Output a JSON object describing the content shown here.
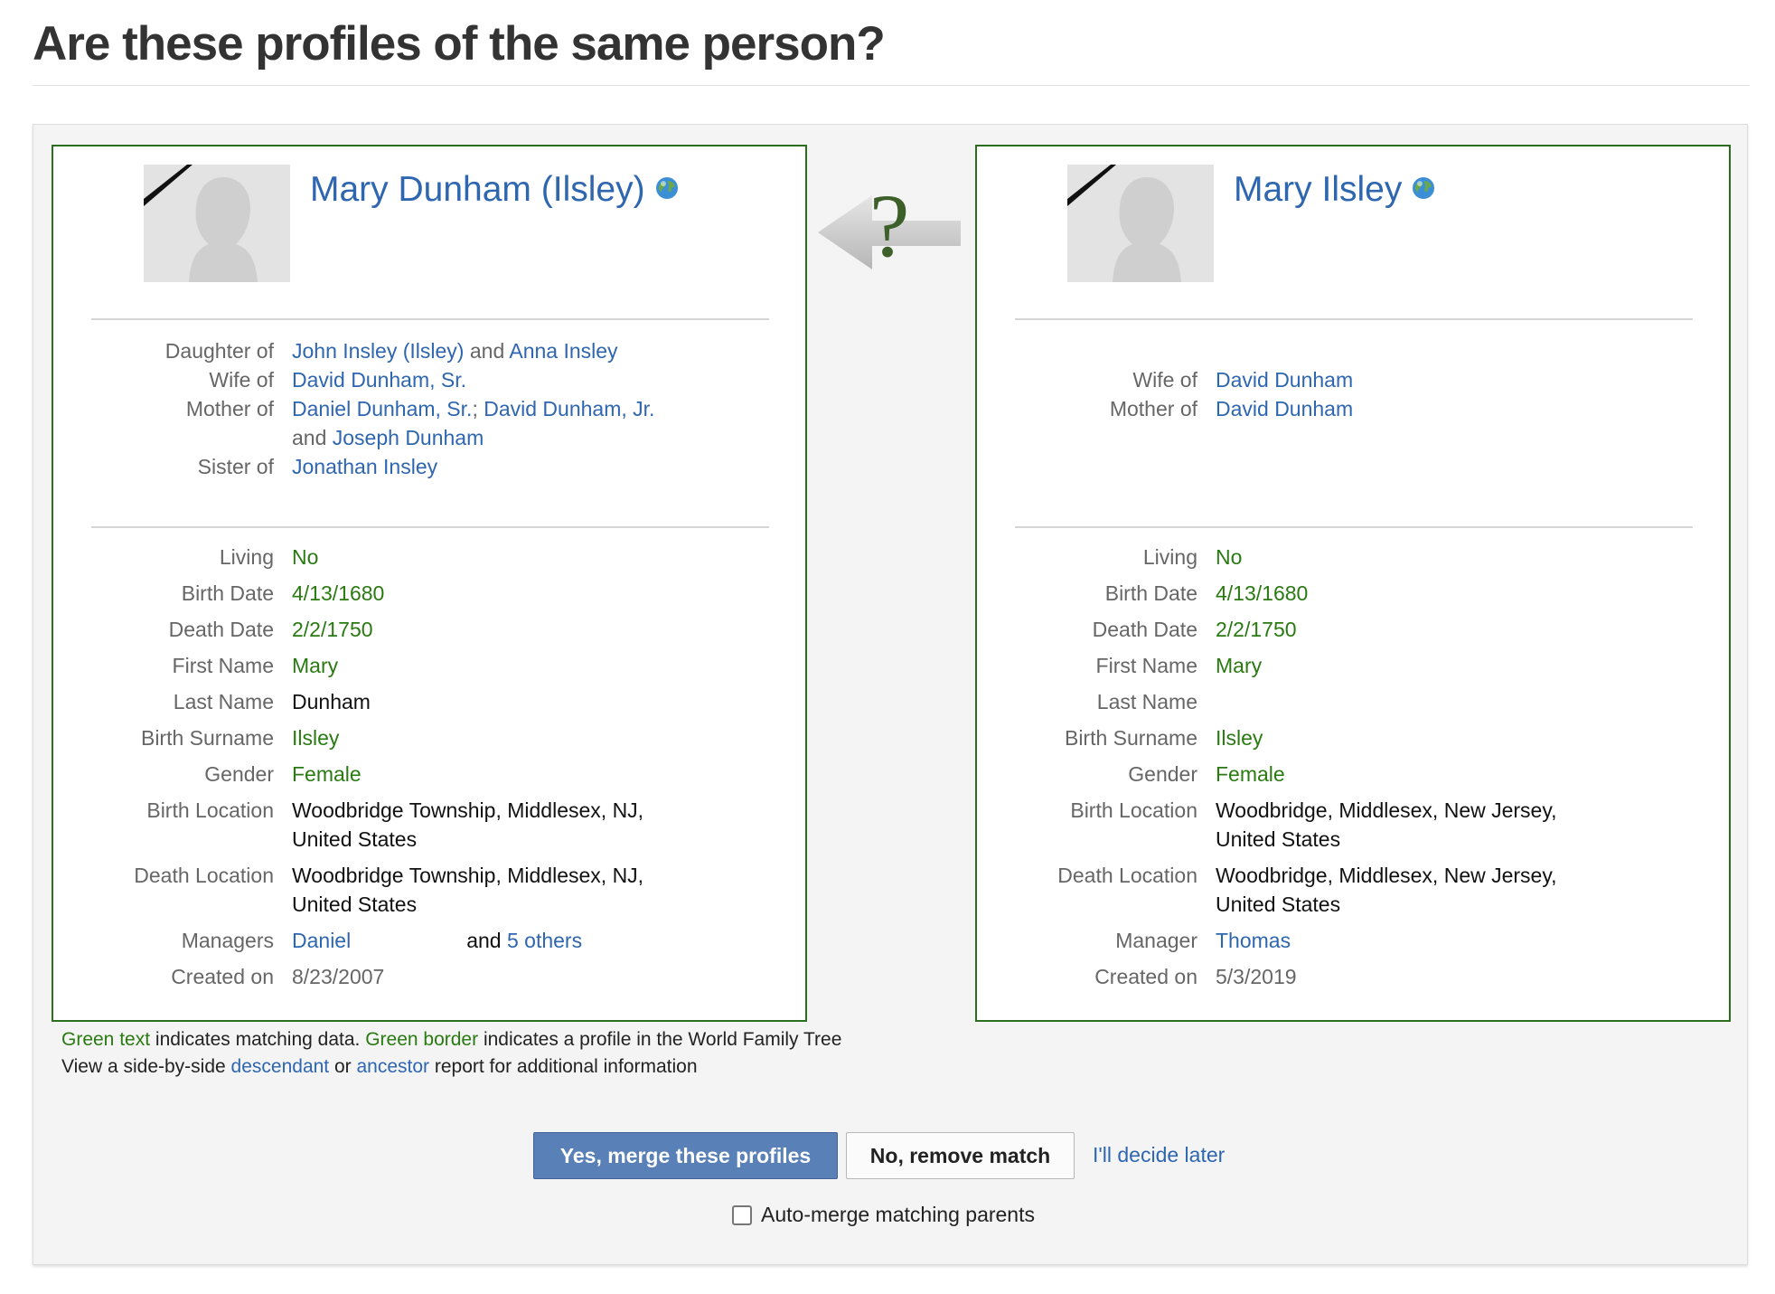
{
  "page": {
    "title": "Are these profiles of the same person?"
  },
  "colors": {
    "link": "#2e66b0",
    "match_green": "#2a7a12",
    "card_border": "#2a6e1e",
    "merge_button": "#5a80b8"
  },
  "icons": {
    "profile_photo": "female-silhouette-icon",
    "deceased_ribbon": "mourning-ribbon-icon",
    "world_tree": "globe-icon",
    "compare": "arrow-left-question-icon"
  },
  "compare_arrow": {
    "symbol": "?"
  },
  "left": {
    "name": "Mary Dunham (Ilsley)",
    "relations": {
      "daughter_of": {
        "label": "Daughter of",
        "parent1": "John Insley (Ilsley)",
        "and": "and",
        "parent2": "Anna Insley"
      },
      "wife_of": {
        "label": "Wife of",
        "spouse": "David Dunham, Sr."
      },
      "mother_of": {
        "label": "Mother of",
        "child1": "Daniel Dunham, Sr.",
        "sep": ";",
        "child2": "David Dunham, Jr.",
        "and": "and",
        "child3": "Joseph Dunham"
      },
      "sister_of": {
        "label": "Sister of",
        "sibling": "Jonathan Insley"
      }
    },
    "fields": {
      "living": {
        "label": "Living",
        "value": "No"
      },
      "birth_date": {
        "label": "Birth Date",
        "value": "4/13/1680"
      },
      "death_date": {
        "label": "Death Date",
        "value": "2/2/1750"
      },
      "first_name": {
        "label": "First Name",
        "value": "Mary"
      },
      "last_name": {
        "label": "Last Name",
        "value": "Dunham"
      },
      "birth_surname": {
        "label": "Birth Surname",
        "value": "Ilsley"
      },
      "gender": {
        "label": "Gender",
        "value": "Female"
      },
      "birth_location": {
        "label": "Birth Location",
        "line1": "Woodbridge Township, Middlesex, NJ,",
        "line2": "United States"
      },
      "death_location": {
        "label": "Death Location",
        "line1": "Woodbridge Township, Middlesex, NJ,",
        "line2": "United States"
      },
      "managers": {
        "label": "Managers",
        "name": "Daniel",
        "and": "and",
        "others": "5 others"
      },
      "created_on": {
        "label": "Created on",
        "value": "8/23/2007"
      }
    }
  },
  "right": {
    "name": "Mary Ilsley",
    "relations": {
      "wife_of": {
        "label": "Wife of",
        "spouse": "David Dunham"
      },
      "mother_of": {
        "label": "Mother of",
        "child1": "David Dunham"
      }
    },
    "fields": {
      "living": {
        "label": "Living",
        "value": "No"
      },
      "birth_date": {
        "label": "Birth Date",
        "value": "4/13/1680"
      },
      "death_date": {
        "label": "Death Date",
        "value": "2/2/1750"
      },
      "first_name": {
        "label": "First Name",
        "value": "Mary"
      },
      "last_name": {
        "label": "Last Name",
        "value": ""
      },
      "birth_surname": {
        "label": "Birth Surname",
        "value": "Ilsley"
      },
      "gender": {
        "label": "Gender",
        "value": "Female"
      },
      "birth_location": {
        "label": "Birth Location",
        "line1": "Woodbridge, Middlesex, New Jersey,",
        "line2": "United States"
      },
      "death_location": {
        "label": "Death Location",
        "line1": "Woodbridge, Middlesex, New Jersey,",
        "line2": "United States"
      },
      "manager": {
        "label": "Manager",
        "name": "Thomas"
      },
      "created_on": {
        "label": "Created on",
        "value": "5/3/2019"
      }
    }
  },
  "legend": {
    "line1": {
      "green_text": "Green text",
      "part1": " indicates matching data. ",
      "green_border": "Green border",
      "part2": " indicates a profile in the World Family Tree"
    },
    "line2": {
      "part1": "View a side-by-side ",
      "descendant": "descendant",
      "or": " or ",
      "ancestor": "ancestor",
      "part2": " report for additional information"
    }
  },
  "actions": {
    "merge": "Yes, merge these profiles",
    "remove": "No, remove match",
    "later": "I'll decide later",
    "auto_merge": "Auto-merge matching parents"
  }
}
